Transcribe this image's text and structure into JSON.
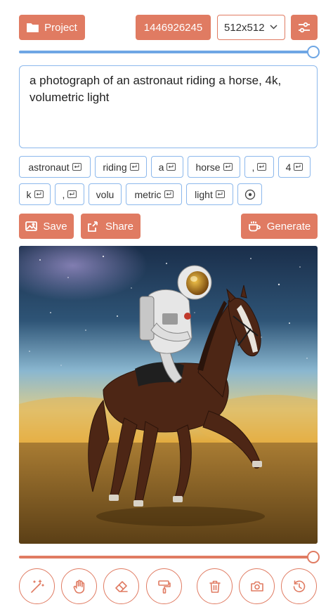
{
  "toolbar": {
    "project_label": "Project",
    "seed_value": "1446926245",
    "size_value": "512x512",
    "settings_icon": "sliders-icon"
  },
  "steps_slider": {
    "value_fraction": 1.0
  },
  "prompt": {
    "text": "a photograph of an astronaut riding a horse, 4k, volumetric light"
  },
  "tokens": [
    "astronaut",
    "riding",
    "a",
    "horse",
    ",",
    "4",
    "k",
    ",",
    "volu",
    "metric",
    "light"
  ],
  "actions": {
    "save_label": "Save",
    "share_label": "Share",
    "generate_label": "Generate"
  },
  "image": {
    "subject": "astronaut riding a horse",
    "palette": {
      "sky_top": "#1b3350",
      "sky_mid": "#7fb2cf",
      "haze": "#e6b64a",
      "ground": "#8a6326",
      "horse": "#4a2414"
    }
  },
  "history_slider": {
    "value_fraction": 1.0
  },
  "tools": [
    {
      "name": "magic-wand-icon"
    },
    {
      "name": "hand-icon"
    },
    {
      "name": "eraser-icon"
    },
    {
      "name": "paint-roller-icon"
    },
    {
      "name": "trash-icon"
    },
    {
      "name": "camera-icon"
    },
    {
      "name": "history-icon"
    }
  ],
  "colors": {
    "accent": "#e07b62",
    "blue": "#6ea6e4",
    "border_blue": "#8cb8ec"
  }
}
